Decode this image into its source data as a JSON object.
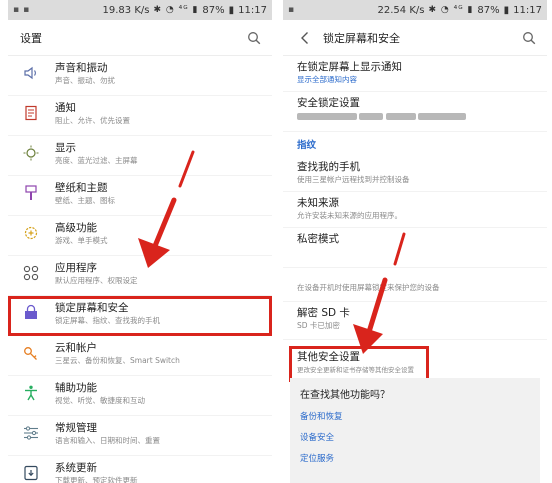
{
  "left_phone": {
    "status": {
      "speed": "19.83 K/s",
      "battery": "87%",
      "time": "11:17"
    },
    "title": "设置",
    "items": [
      {
        "title": "声音和振动",
        "subtitle": "声音、振动、勿扰",
        "icon": "speaker-icon"
      },
      {
        "title": "通知",
        "subtitle": "阻止、允许、优先设置",
        "icon": "notification-icon"
      },
      {
        "title": "显示",
        "subtitle": "亮度、蓝光过滤、主屏幕",
        "icon": "display-icon"
      },
      {
        "title": "壁纸和主题",
        "subtitle": "壁纸、主题、图标",
        "icon": "brush-icon"
      },
      {
        "title": "高级功能",
        "subtitle": "游戏、单手模式",
        "icon": "gear-plus-icon"
      },
      {
        "title": "应用程序",
        "subtitle": "默认应用程序、权限设定",
        "icon": "apps-grid-icon"
      },
      {
        "title": "锁定屏幕和安全",
        "subtitle": "锁定屏幕、指纹、查找我的手机",
        "icon": "lock-screen-icon"
      },
      {
        "title": "云和帐户",
        "subtitle": "三星云、备份和恢复、Smart Switch",
        "icon": "key-icon"
      },
      {
        "title": "辅助功能",
        "subtitle": "视觉、听觉、敏捷度和互动",
        "icon": "accessibility-icon"
      },
      {
        "title": "常规管理",
        "subtitle": "语言和输入、日期和时间、重置",
        "icon": "sliders-icon"
      },
      {
        "title": "系统更新",
        "subtitle": "下载更新、预定软件更新",
        "icon": "system-update-icon"
      }
    ]
  },
  "right_phone": {
    "status": {
      "speed": "22.54 K/s",
      "battery": "87%",
      "time": "11:17"
    },
    "title": "锁定屏幕和安全",
    "items": [
      {
        "title": "在锁定屏幕上显示通知",
        "subtitle": "显示全部通知内容"
      },
      {
        "title": "安全锁定设置",
        "subtitle": ""
      },
      {
        "header": "指纹"
      },
      {
        "title": "查找我的手机",
        "subtitle": "使用三星帐户远程找到并控制设备"
      },
      {
        "title": "未知来源",
        "subtitle": "允许安装未知来源的应用程序。"
      },
      {
        "title": "私密模式",
        "subtitle": ""
      },
      {
        "title": "",
        "subtitle": "在设备开机时使用屏幕锁定来保护您的设备"
      },
      {
        "title": "解密 SD 卡",
        "subtitle": "SD 卡已加密"
      },
      {
        "title": "其他安全设置",
        "subtitle": "更改安全更新和证书存储等其他安全设置"
      }
    ],
    "suggest": {
      "question": "在查找其他功能吗？",
      "links": [
        "备份和恢复",
        "设备安全",
        "定位服务"
      ]
    }
  },
  "colors": {
    "highlight": "#d9241c",
    "link": "#2a6acb"
  }
}
